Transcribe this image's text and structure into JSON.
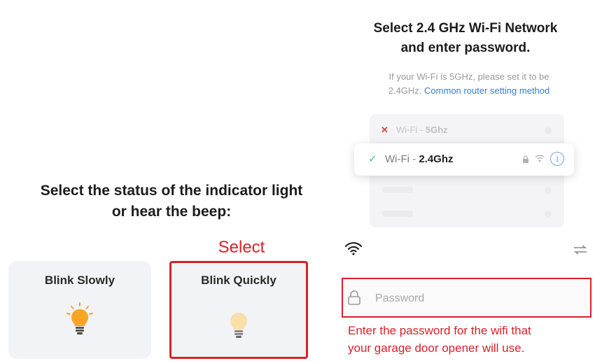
{
  "left": {
    "title_line1": "Select the status of the indicator light",
    "title_line2": "or hear the beep:",
    "annotation": "Select",
    "options": [
      {
        "label": "Blink Slowly",
        "icon": "lightbulb-icon"
      },
      {
        "label": "Blink Quickly",
        "icon": "lightbulb-icon"
      }
    ]
  },
  "right": {
    "title_line1": "Select 2.4 GHz Wi-Fi Network",
    "title_line2": "and enter password.",
    "hint_line1": "If your Wi-Fi is 5GHz, please set it to be",
    "hint_prefix": "2.4GHz.",
    "hint_link": "Common router setting method",
    "networks": [
      {
        "prefix": "Wi-Fi - ",
        "band": "5Ghz",
        "status": "unsupported"
      },
      {
        "prefix": "Wi-Fi - ",
        "band": "2.4Ghz",
        "status": "supported"
      }
    ],
    "password_placeholder": "Password",
    "annotation_line1": "Enter the password for the wifi that",
    "annotation_line2": "your garage door opener will use."
  },
  "colors": {
    "annotation_red": "#d8202a",
    "link_blue": "#3a7bd5",
    "check_teal": "#3fb8a8",
    "bulb_amber": "#f5a623"
  }
}
